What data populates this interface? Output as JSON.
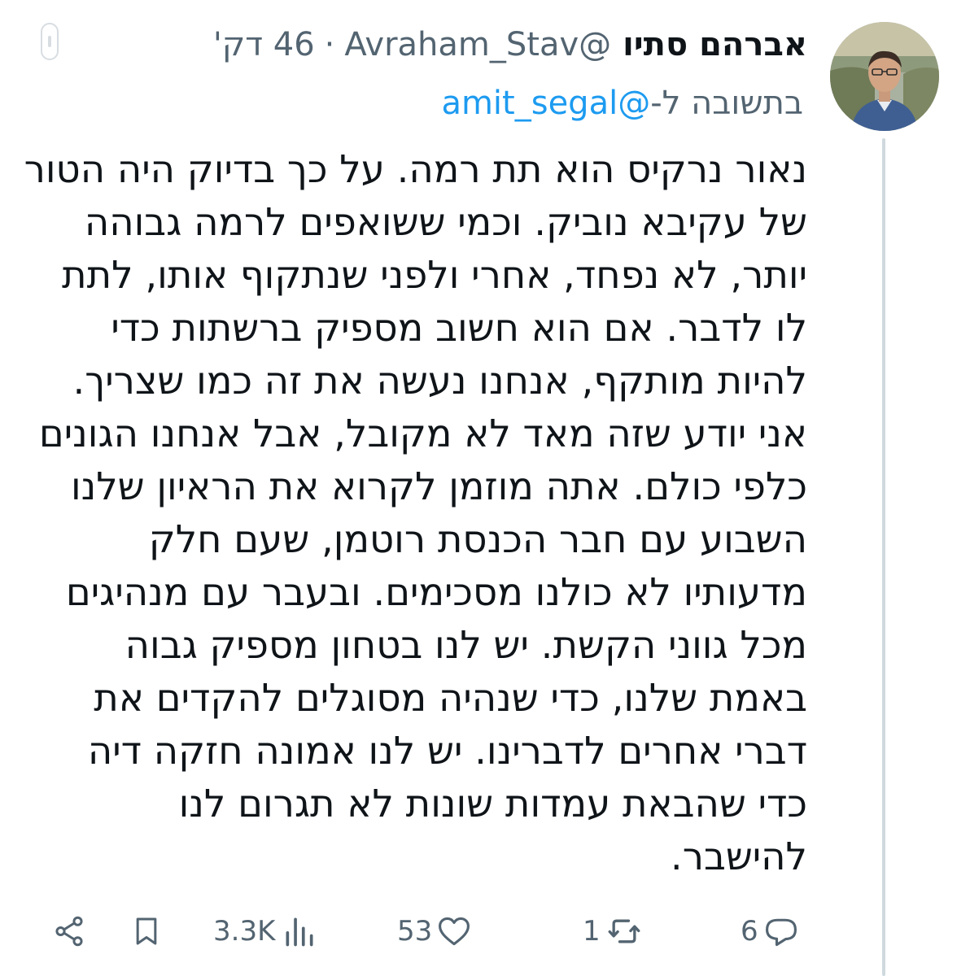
{
  "author": {
    "display_name": "אברהם סתיו",
    "handle": "@Avraham_Stav",
    "separator": "·",
    "time_ago": "46 דק'"
  },
  "reply_context": {
    "prefix": "בתשובה ל-",
    "mention": "@amit_segal"
  },
  "tweet": {
    "lines": [
      "נאור נרקיס הוא תת רמה. על כך בדיוק היה הטור",
      "של עקיבא נוביק. וכמי ששואפים לרמה גבוהה",
      "יותר, לא נפחד, אחרי ולפני שנתקוף אותו, לתת",
      "לו לדבר. אם הוא חשוב מספיק ברשתות כדי",
      "להיות מותקף, אנחנו נעשה את זה כמו שצריך.",
      "אני יודע שזה מאד לא מקובל, אבל אנחנו הגונים",
      "כלפי כולם. אתה מוזמן לקרוא את הראיון שלנו",
      "השבוע עם חבר הכנסת רוטמן, שעם חלק",
      "מדעותיו לא כולנו מסכימים. ובעבר עם מנהיגים",
      "מכל גווני הקשת. יש לנו בטחון מספיק גבוה",
      "באמת שלנו, כדי שנהיה מסוגלים להקדים את",
      "דברי אחרים לדברינו. יש לנו אמונה חזקה דיה",
      "כדי שהבאת עמדות שונות לא תגרום לנו",
      "להישבר."
    ]
  },
  "actions": {
    "replies": "6",
    "retweets": "1",
    "likes": "53",
    "views": "3.3K"
  },
  "icons": {
    "reply": "speech-bubble-icon",
    "retweet": "retweet-arrows-icon",
    "like": "heart-icon",
    "views": "bar-chart-icon",
    "bookmark": "bookmark-icon",
    "share": "share-icon"
  },
  "colors": {
    "text": "#0f1419",
    "secondary": "#536471",
    "link": "#1d9bf0",
    "thread_line": "#cfd9de"
  }
}
